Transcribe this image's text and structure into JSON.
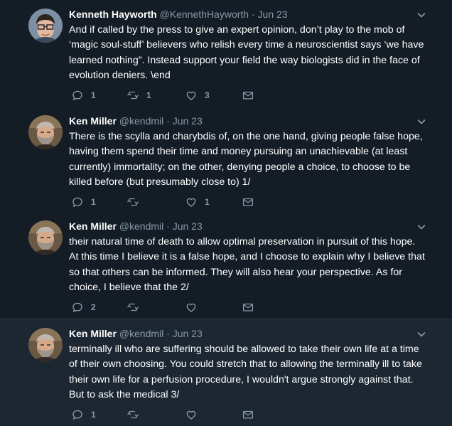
{
  "colors": {
    "background": "#141d26",
    "text": "#ffffff",
    "secondary": "#8899a6"
  },
  "tweets": [
    {
      "name": "Kenneth Hayworth",
      "handle": "@KennethHayworth",
      "dot": "·",
      "time": "Jun 23",
      "lines": [
        "And if called by the press to give an expert opinion, don’t play to the mob of",
        "‘magic soul-stuff’ believers who relish every time a neuroscientist says ‘we have",
        "learned nothing”. Instead support your field the way biologists did in the face of",
        "evolution deniers. \\end"
      ],
      "replies": "1",
      "retweets": "1",
      "likes": "3"
    },
    {
      "name": "Ken Miller",
      "handle": "@kendmil",
      "dot": "·",
      "time": "Jun 23",
      "lines": [
        "There is the scylla and charybdis of, on the one hand, giving people false hope,",
        "having them spend their time and money pursuing an unachievable (at least",
        "currently) immortality; on the other, denying people a choice, to choose to be",
        "killed before (but presumably close to) 1/"
      ],
      "replies": "1",
      "retweets": "",
      "likes": "1"
    },
    {
      "name": "Ken Miller",
      "handle": "@kendmil",
      "dot": "·",
      "time": "Jun 23",
      "lines": [
        "their natural time of death to allow optimal preservation in pursuit of this hope.",
        "At this time I believe it is a false hope, and I choose to explain why I believe that",
        "so that others can be informed. They will also hear your perspective. As for",
        "choice, I believe that the 2/"
      ],
      "replies": "2",
      "retweets": "",
      "likes": ""
    },
    {
      "name": "Ken Miller",
      "handle": "@kendmil",
      "dot": "·",
      "time": "Jun 23",
      "lines": [
        "terminally ill who are suffering should be allowed to take their own life at a time",
        "of their own choosing. You could stretch that to allowing the terminally ill to take",
        "their own life for a perfusion procedure, I wouldn't argue strongly against that.",
        "But to ask the medical 3/"
      ],
      "replies": "1",
      "retweets": "",
      "likes": ""
    }
  ]
}
